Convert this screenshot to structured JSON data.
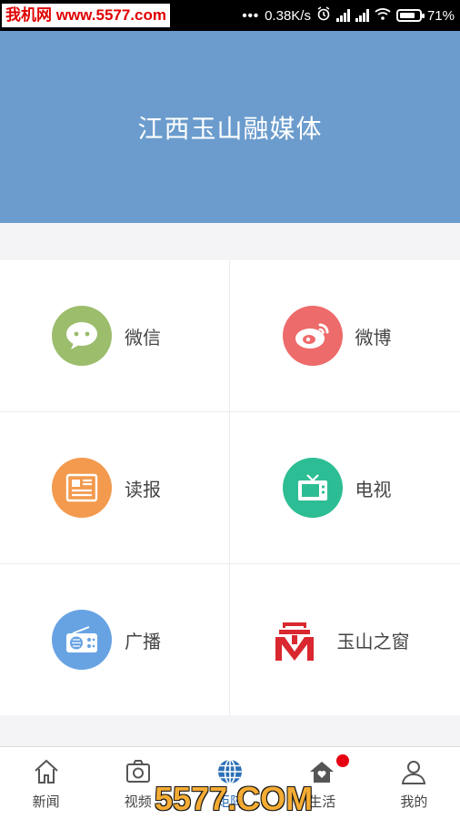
{
  "status_bar": {
    "watermark": "我机网 www.5577.com",
    "speed": "0.38K/s",
    "battery": "71%",
    "icons": [
      "more-dots-icon",
      "alarm-icon",
      "signal-icon",
      "signal-icon",
      "wifi-icon",
      "battery-icon"
    ]
  },
  "banner": {
    "title": "江西玉山融媒体",
    "color": "#6b9ccd"
  },
  "grid": {
    "items": [
      {
        "label": "微信",
        "icon": "wechat-icon",
        "color": "#9bbd6c"
      },
      {
        "label": "微博",
        "icon": "weibo-icon",
        "color": "#ee6b6b"
      },
      {
        "label": "读报",
        "icon": "newspaper-icon",
        "color": "#f39a4e"
      },
      {
        "label": "电视",
        "icon": "tv-icon",
        "color": "#2dbd94"
      },
      {
        "label": "广播",
        "icon": "radio-icon",
        "color": "#67a3e3"
      },
      {
        "label": "玉山之窗",
        "icon": "yushan-logo-icon",
        "color": "#d9282f"
      }
    ]
  },
  "tabbar": {
    "items": [
      {
        "label": "新闻",
        "icon": "home-icon"
      },
      {
        "label": "视频",
        "icon": "camera-icon"
      },
      {
        "label": "矩阵",
        "icon": "globe-icon",
        "active": true
      },
      {
        "label": "生活",
        "icon": "house-heart-icon",
        "badge": true
      },
      {
        "label": "我的",
        "icon": "user-icon"
      }
    ],
    "active_color": "#2c6fb6"
  },
  "overlay_watermark": "5577.COM"
}
